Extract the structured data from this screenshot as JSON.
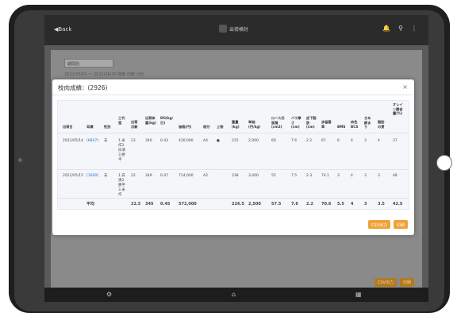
{
  "topbar": {
    "back_label": "◀Back",
    "brand": "出荷検討",
    "icons": [
      "bell-icon",
      "search-icon",
      "more-icon"
    ]
  },
  "filters": {
    "select_value": "期間別",
    "date_range": "2021/05/01 ～ 2021/06/30  検索  印刷  分析"
  },
  "background_buttons": {
    "csv": "CSV出力",
    "print": "印刷"
  },
  "modal": {
    "title": "枝肉成績：(2926)",
    "close": "×",
    "headers": [
      "出荷日",
      "耳標",
      "性別",
      "三代祖",
      "出荷月齢",
      "出荷体重(kg)",
      "DG(kg/日)",
      "価格(円)",
      "格付",
      "上物",
      "重量(kg)",
      "単価(円/kg)",
      "ロース芯面積(cm2)",
      "バラ厚さ(cm)",
      "皮下脂肪(cm)",
      "歩留基準",
      "BMS",
      "肉色BCS",
      "きめ締まり",
      "脂肪の質",
      "オレイン酸含量(%)"
    ],
    "rows": [
      {
        "date": "2021/05/14",
        "ear": "[6847]",
        "sex": "去",
        "sire": "1.米作2.白清3.勝平",
        "age": "23",
        "weight": "340",
        "dg": "0.43",
        "price": "430,000",
        "grade": "A4",
        "top": "●",
        "carcass": "215",
        "unit": "2,000",
        "loin": "60",
        "rib": "7.6",
        "fat": "2.2",
        "yield": "67",
        "bms": "6",
        "bcs": "4",
        "kime": "3",
        "fatq": "4",
        "olein": "37"
      },
      {
        "date": "2021/05/15",
        "ear": "[1609]",
        "sex": "去",
        "sire": "1.白清2.勝平3.米作",
        "age": "22",
        "weight": "349",
        "dg": "0.47",
        "price": "714,000",
        "grade": "A2",
        "top": "",
        "carcass": "238",
        "unit": "3,000",
        "loin": "55",
        "rib": "7.5",
        "fat": "2.3",
        "yield": "74.1",
        "bms": "3",
        "bcs": "4",
        "kime": "3",
        "fatq": "3",
        "olein": "48"
      }
    ],
    "average": {
      "label": "平均",
      "age": "22.5",
      "weight": "345",
      "dg": "0.45",
      "price": "572,000",
      "carcass": "226.5",
      "unit": "2,500",
      "loin": "57.5",
      "rib": "7.6",
      "fat": "2.2",
      "yield": "70.6",
      "bms": "5.5",
      "bcs": "4",
      "kime": "3",
      "fatq": "3.5",
      "olein": "42.5"
    },
    "buttons": {
      "csv": "CSV出力",
      "print": "印刷"
    }
  },
  "footer": {
    "icons": [
      "gear-icon",
      "home-icon",
      "calendar-icon"
    ]
  }
}
